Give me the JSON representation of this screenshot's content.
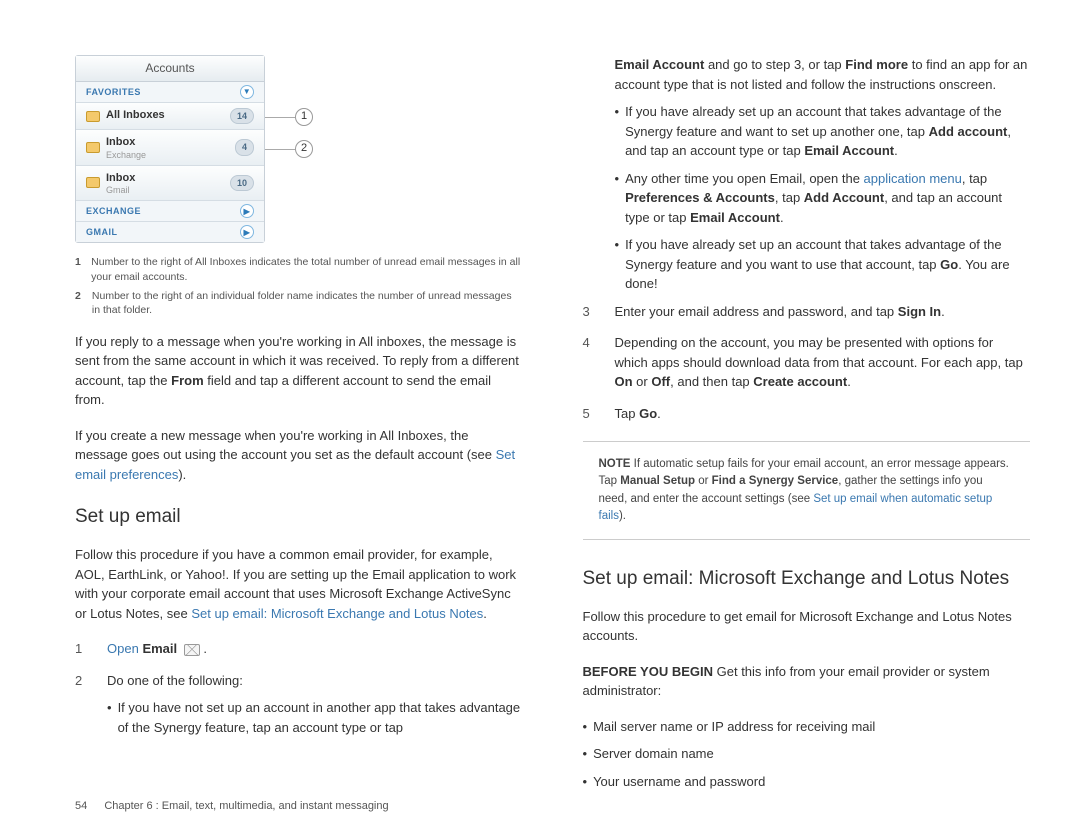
{
  "phone": {
    "title": "Accounts",
    "favorites_label": "FAVORITES",
    "all_inboxes": {
      "label": "All Inboxes",
      "count": "14"
    },
    "inbox_exchange": {
      "label": "Inbox",
      "sub": "Exchange",
      "count": "4"
    },
    "inbox_gmail": {
      "label": "Inbox",
      "sub": "Gmail",
      "count": "10"
    },
    "exchange_label": "EXCHANGE",
    "gmail_label": "GMAIL"
  },
  "callouts": {
    "one": "1",
    "two": "2"
  },
  "legend": {
    "l1": "Number to the right of All Inboxes indicates the total number of unread email messages in all your email accounts.",
    "l2": "Number to the right of an individual folder name indicates the number of unread messages in that folder."
  },
  "para1": "If you reply to a message when you're working in All inboxes, the message is sent from the same account in which it was received. To reply from a different account, tap the ",
  "para1b": " field and tap a different account to send the email from.",
  "from_label": "From",
  "para2a": "If you create a new message when you're working in All Inboxes, the message goes out using the account you set as the default account (see ",
  "para2b": ").",
  "link_prefs": "Set email preferences",
  "h_setup": "Set up email",
  "setup_intro_a": "Follow this procedure if you have a common email provider, for example, AOL, EarthLink, or Yahoo!. If you are setting up the Email application to work with your corporate email account that uses Microsoft Exchange ActiveSync or Lotus Notes, see ",
  "link_exchange": "Set up email: Microsoft Exchange and Lotus Notes",
  "step1_open": "Open",
  "step1_email": "Email",
  "step2": "Do one of the following:",
  "s2_b1": "If you have not set up an account in another app that takes advantage of the Synergy feature, tap an account type or tap ",
  "right": {
    "email_account": "Email Account",
    "cont1a": " and go to step 3, or tap ",
    "find_more": "Find more",
    "cont1b": " to find an app for an account type that is not listed and follow the instructions onscreen.",
    "b2a": "If you have already set up an account that takes advantage of the Synergy feature and want to set up another one, tap ",
    "add_account": "Add account",
    "b2b": ", and tap an account type or tap ",
    "b3a": "Any other time you open Email, open the ",
    "app_menu": "application menu",
    "b3b": ", tap ",
    "prefs_accounts": "Preferences & Accounts",
    "b3c": ", tap ",
    "add_account2": "Add Account",
    "b3d": ", and tap an account type or tap ",
    "b4a": "If you have already set up an account that takes advantage of the Synergy feature and you want to use that account, tap ",
    "go": "Go",
    "b4b": ". You are done!",
    "step3a": "Enter your email address and password, and tap ",
    "sign_in": "Sign In",
    "step4a": "Depending on the account, you may be presented with options for which apps should download data from that account. For each app, tap ",
    "on": "On",
    "or": " or ",
    "off": "Off",
    "step4b": ", and then tap ",
    "create_account": "Create account",
    "step5": "Tap ",
    "note_label": "NOTE",
    "note_a": "  If automatic setup fails for your email account, an error message appears. Tap ",
    "manual_setup": "Manual Setup",
    "note_or": " or ",
    "find_synergy": "Find a Synergy Service",
    "note_b": ", gather the settings info you need, and enter the account settings (see ",
    "link_fail": "Set up email when automatic setup fails",
    "note_c": ")."
  },
  "h_exchange": "Set up email: Microsoft Exchange and Lotus Notes",
  "ex_intro": "Follow this procedure to get email for Microsoft Exchange and Lotus Notes accounts.",
  "before_label": "BEFORE YOU BEGIN",
  "before_text": "  Get this info from your email provider or system administrator:",
  "before_items": [
    "Mail server name or IP address for receiving mail",
    "Server domain name",
    "Your username and password"
  ],
  "footer": {
    "page": "54",
    "chapter": "Chapter 6 : Email, text, multimedia, and instant messaging"
  },
  "nums": {
    "n1": "1",
    "n2": "2",
    "n3": "3",
    "n4": "4",
    "n5": "5"
  }
}
